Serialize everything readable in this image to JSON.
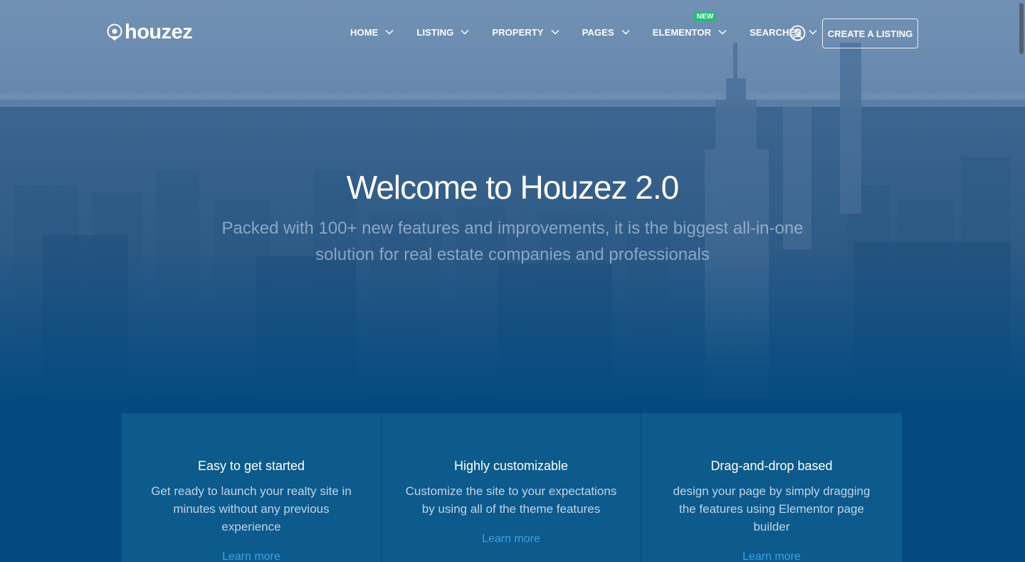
{
  "brand": {
    "name": "houzez"
  },
  "nav": {
    "items": [
      {
        "label": "HOME"
      },
      {
        "label": "LISTING"
      },
      {
        "label": "PROPERTY"
      },
      {
        "label": "PAGES"
      },
      {
        "label": "ELEMENTOR",
        "badge": "NEW"
      },
      {
        "label": "SEARCHES"
      }
    ],
    "cta_label": "CREATE A LISTING"
  },
  "hero": {
    "title": "Welcome to Houzez 2.0",
    "subtitle": "Packed with 100+ new features and improvements, it is the biggest all-in-one solution for real estate companies and professionals"
  },
  "features": [
    {
      "title": "Easy to get started",
      "text": "Get ready to launch your realty site in minutes without any previous experience",
      "link": "Learn more"
    },
    {
      "title": "Highly customizable",
      "text": "Customize the site to your expectations by using all of the theme features",
      "link": "Learn more"
    },
    {
      "title": "Drag-and-drop based",
      "text": "design your page by simply dragging the features using Elementor page builder",
      "link": "Learn more"
    }
  ],
  "colors": {
    "accent": "#3aa3e6",
    "badge": "#1fbf74",
    "background": "#044a80"
  },
  "icons": {
    "logo": "map-pin-icon",
    "user": "user-circle-icon",
    "chevron": "chevron-down-icon"
  }
}
